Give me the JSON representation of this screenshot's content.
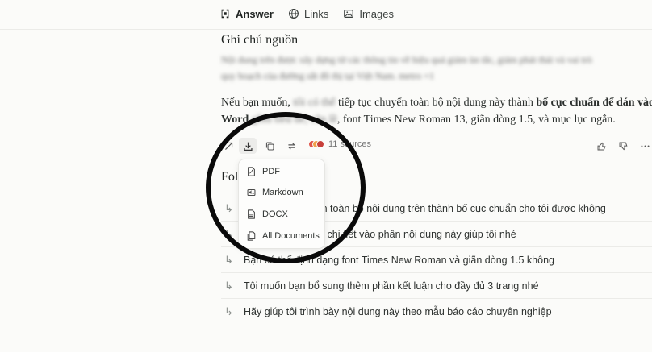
{
  "tabs": [
    {
      "label": "Answer",
      "icon": "answer-icon",
      "active": true
    },
    {
      "label": "Links",
      "icon": "globe-icon",
      "active": false
    },
    {
      "label": "Images",
      "icon": "image-icon",
      "active": false
    }
  ],
  "notes": {
    "title": "Ghi chú nguồn",
    "blurred_line1": "Nội dung trên được xây dựng từ các thông tin về hiệu quả giảm ùn tắc, giảm phát thải và vai trò",
    "blurred_line2": "quy hoạch của đường sắt đô thị tại Việt Nam.",
    "blurred_ref": "metro +1"
  },
  "paragraph": {
    "p1": "Nếu bạn muốn,",
    "p1_blur": "tôi có thể",
    "p2": "tiếp tục chuyển toàn bộ nội dung này thành",
    "bold1": "bố cục chuẩn để dán vào",
    "bold2": "Word",
    "p3_blur": "gồm tiêu đề, căn lề",
    "p4": ", font Times New Roman 13, giãn dòng 1.5, và mục lục ngắn."
  },
  "actions": {
    "sources_label": "11 sources",
    "source_colors": [
      "#e0554b",
      "#f0a04a",
      "#c8403a"
    ]
  },
  "related": {
    "title_visible": "Foll",
    "items": [
      "Bạn có thể chuyển toàn bộ nội dung trên thành bố cục chuẩn cho tôi được không",
      "Hãy thêm mục lục chi tiết vào phần nội dung này giúp tôi nhé",
      "Bạn có thể định dạng font Times New Roman và giãn dòng 1.5 không",
      "Tôi muốn bạn bổ sung thêm phần kết luận cho đầy đủ 3 trang nhé",
      "Hãy giúp tôi trình bày nội dung này theo mẫu báo cáo chuyên nghiệp"
    ]
  },
  "download_menu": {
    "items": [
      {
        "label": "PDF",
        "icon": "pdf-file-icon"
      },
      {
        "label": "Markdown",
        "icon": "markdown-icon"
      },
      {
        "label": "DOCX",
        "icon": "docx-file-icon"
      },
      {
        "label": "All Documents",
        "icon": "documents-icon"
      }
    ]
  }
}
